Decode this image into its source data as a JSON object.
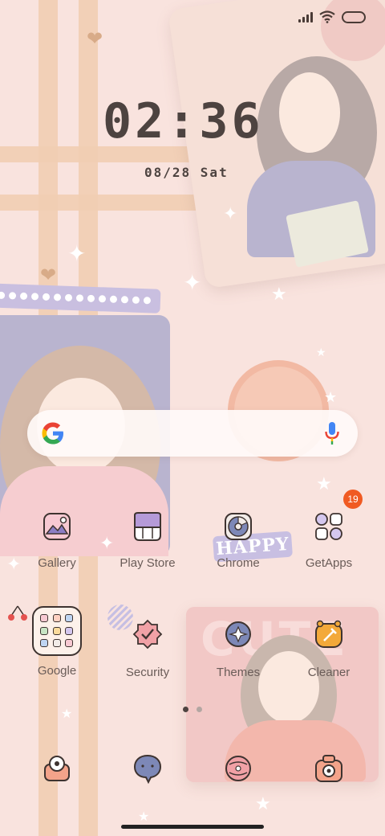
{
  "status_bar": {
    "signal_icon": "signal-icon",
    "wifi_icon": "wifi-icon",
    "battery_icon": "battery-icon"
  },
  "clock": {
    "time": "02:36",
    "date": "08/28 Sat"
  },
  "search": {
    "google_icon": "google-g-icon",
    "mic_icon": "mic-icon"
  },
  "wallpaper": {
    "happy_text": "HAPPY",
    "cute_text": "CUTE"
  },
  "apps_row1": [
    {
      "label": "Gallery",
      "icon": "gallery-icon"
    },
    {
      "label": "Play Store",
      "icon": "play-store-icon"
    },
    {
      "label": "Chrome",
      "icon": "chrome-icon"
    },
    {
      "label": "GetApps",
      "icon": "getapps-icon",
      "badge": "19"
    }
  ],
  "apps_row2": [
    {
      "label": "Google",
      "icon": "google-folder-icon"
    },
    {
      "label": "Security",
      "icon": "security-icon"
    },
    {
      "label": "Themes",
      "icon": "themes-icon"
    },
    {
      "label": "Cleaner",
      "icon": "cleaner-icon"
    }
  ],
  "dock": [
    {
      "icon": "phone-icon"
    },
    {
      "icon": "messages-icon"
    },
    {
      "icon": "browser-icon"
    },
    {
      "icon": "camera-icon"
    }
  ],
  "pages": {
    "count": 2,
    "active": 1
  },
  "colors": {
    "background": "#f9e3de",
    "text_dark": "#4d4340",
    "label": "#6a5c58",
    "badge": "#f05a22",
    "stripe": "#f1cdb3"
  }
}
